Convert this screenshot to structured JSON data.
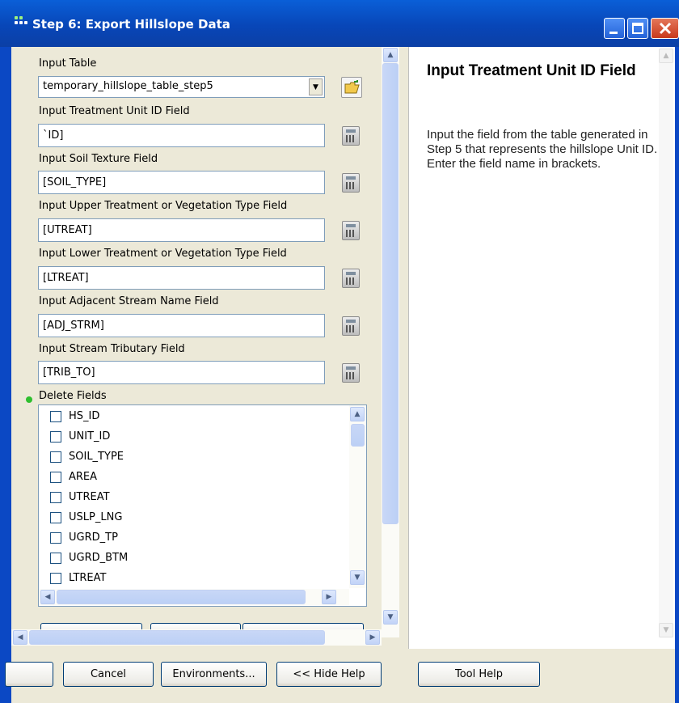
{
  "window": {
    "title": "Step 6: Export Hillslope Data"
  },
  "form": {
    "input_table": {
      "label": "Input Table",
      "value": "temporary_hillslope_table_step5"
    },
    "treatment_unit_id": {
      "label": "Input Treatment Unit ID Field",
      "value": "`ID]"
    },
    "soil_texture": {
      "label": "Input Soil Texture Field",
      "value": "[SOIL_TYPE]"
    },
    "upper_treatment": {
      "label": "Input Upper Treatment or Vegetation Type Field",
      "value": "[UTREAT]"
    },
    "lower_treatment": {
      "label": "Input Lower Treatment or Vegetation Type Field",
      "value": "[LTREAT]"
    },
    "adjacent_stream": {
      "label": "Input Adjacent Stream Name Field",
      "value": "[ADJ_STRM]"
    },
    "stream_tributary": {
      "label": "Input Stream Tributary Field",
      "value": "[TRIB_TO]"
    },
    "delete_fields": {
      "label": "Delete Fields",
      "items": [
        "HS_ID",
        "UNIT_ID",
        "SOIL_TYPE",
        "AREA",
        "UTREAT",
        "USLP_LNG",
        "UGRD_TP",
        "UGRD_BTM",
        "LTREAT"
      ]
    }
  },
  "help": {
    "title": "Input Treatment Unit ID Field",
    "body": "Input the field from the table generated in Step 5 that represents the hillslope Unit ID. Enter the field name in brackets."
  },
  "buttons": {
    "cancel": "Cancel",
    "environments": "Environments...",
    "hide_help": "<< Hide Help",
    "tool_help": "Tool Help"
  },
  "colors": {
    "title_bar": "#0846b8",
    "required_dot": "#2fbf2f"
  }
}
